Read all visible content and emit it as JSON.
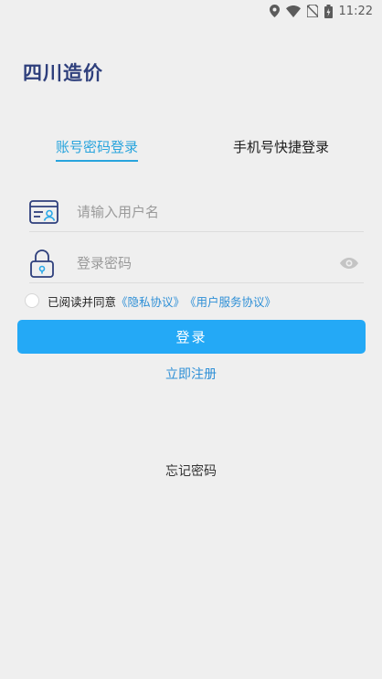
{
  "status_bar": {
    "time": "11:22",
    "icons": [
      "location-icon",
      "wifi-icon",
      "no-sim-icon",
      "battery-icon"
    ]
  },
  "app": {
    "title": "四川造价"
  },
  "tabs": [
    {
      "label": "账号密码登录",
      "active": true
    },
    {
      "label": "手机号快捷登录",
      "active": false
    }
  ],
  "form": {
    "username": {
      "value": "",
      "placeholder": "请输入用户名",
      "icon": "id-card-icon"
    },
    "password": {
      "value": "",
      "placeholder": "登录密码",
      "icon": "lock-icon"
    },
    "agreement": {
      "prefix": "已阅读并同意",
      "privacy_link": "《隐私协议》",
      "service_link": "《用户服务协议》",
      "checked": false
    },
    "login_label": "登录",
    "register_label": "立即注册",
    "forgot_label": "忘记密码"
  },
  "colors": {
    "accent": "#24a9f6",
    "tab_active": "#28a4dd",
    "link": "#2e8fd6",
    "title": "#2e3f7c",
    "background": "#efefef"
  }
}
